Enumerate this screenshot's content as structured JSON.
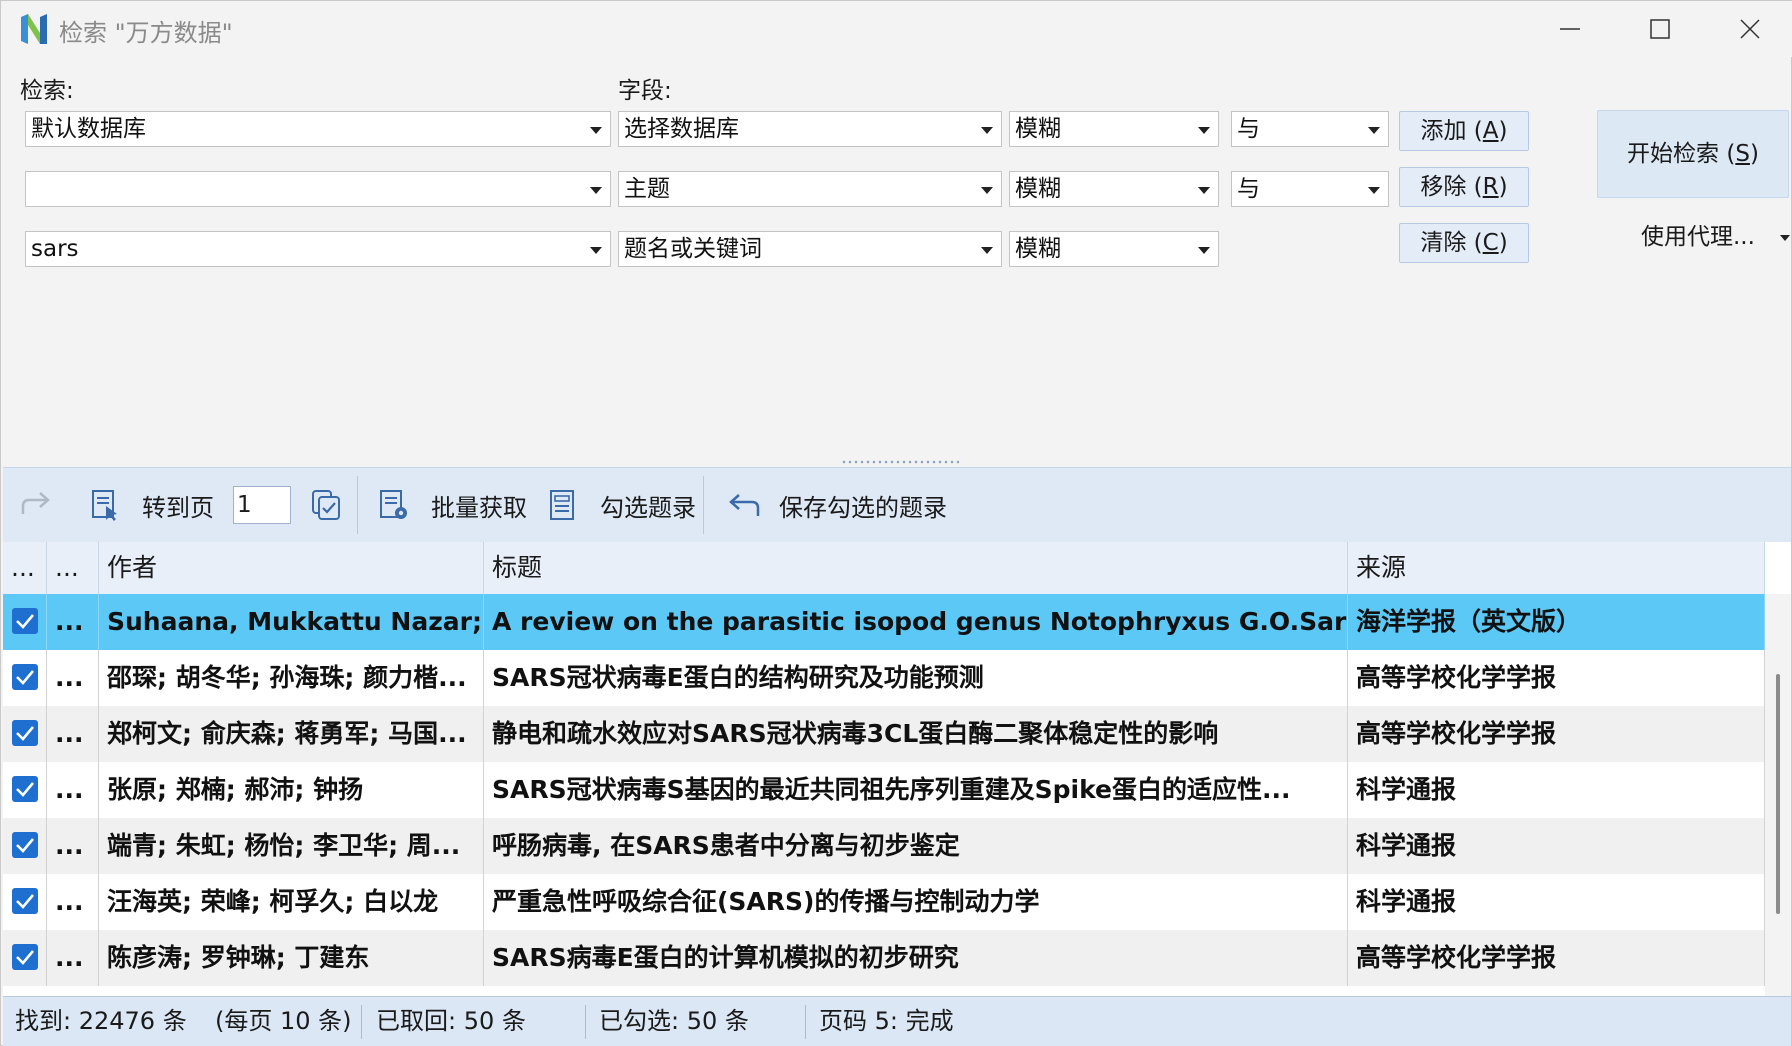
{
  "window": {
    "title": "检索 \"万方数据\"",
    "icons": {
      "app": "wanfang-logo-icon",
      "minimize": "minimize-icon",
      "maximize": "maximize-icon",
      "close": "close-icon"
    }
  },
  "search": {
    "search_label": "检索:",
    "field_label": "字段:",
    "rows": [
      {
        "database": "默认数据库",
        "field": "选择数据库",
        "match": "模糊",
        "logic": "与"
      },
      {
        "database": "",
        "field": "主题",
        "match": "模糊",
        "logic": "与"
      },
      {
        "database": "sars",
        "field": "题名或关键词",
        "match": "模糊"
      }
    ],
    "buttons": {
      "add": {
        "label": "添加 (",
        "key": "A",
        "end": ")"
      },
      "remove": {
        "label": "移除 (",
        "key": "R",
        "end": ")"
      },
      "clear": {
        "label": "清除 (",
        "key": "C",
        "end": ")"
      },
      "start": {
        "label": "开始检索 (",
        "key": "S",
        "end": ")"
      }
    },
    "proxy_label": "使用代理..."
  },
  "toolbar": {
    "goto_page_label": "转到页",
    "page_value": "1",
    "batch_fetch_label": "批量获取",
    "check_records_label": "勾选题录",
    "save_checked_label": "保存勾选的题录",
    "icons": [
      "forward-arrow-icon",
      "document-cursor-icon",
      "copy-check-icon",
      "document-gear-icon",
      "list-document-icon",
      "return-arrow-icon"
    ]
  },
  "grid": {
    "headers": [
      "...",
      "...",
      "作者",
      "标题",
      "来源"
    ],
    "rows": [
      {
        "checked": true,
        "more": "...",
        "author": "Suhaana, Mukkattu Nazar;...",
        "title": "A review on the parasitic isopod genus Notophryxus G.O.Sars,",
        "source": "海洋学报（英文版）"
      },
      {
        "checked": true,
        "more": "...",
        "author": "邵琛; 胡冬华; 孙海珠; 颜力楷...",
        "title": "SARS冠状病毒E蛋白的结构研究及功能预测",
        "source": "高等学校化学学报"
      },
      {
        "checked": true,
        "more": "...",
        "author": "郑柯文; 俞庆森; 蒋勇军; 马国...",
        "title": "静电和疏水效应对SARS冠状病毒3CL蛋白酶二聚体稳定性的影响",
        "source": "高等学校化学学报"
      },
      {
        "checked": true,
        "more": "...",
        "author": "张原; 郑楠; 郝沛; 钟扬",
        "title": "SARS冠状病毒S基因的最近共同祖先序列重建及Spike蛋白的适应性...",
        "source": "科学通报"
      },
      {
        "checked": true,
        "more": "...",
        "author": "端青; 朱虹; 杨怡; 李卫华; 周...",
        "title": "呼肠病毒, 在SARS患者中分离与初步鉴定",
        "source": "科学通报"
      },
      {
        "checked": true,
        "more": "...",
        "author": "汪海英; 荣峰; 柯孚久; 白以龙",
        "title": "严重急性呼吸综合征(SARS)的传播与控制动力学",
        "source": "科学通报"
      },
      {
        "checked": true,
        "more": "...",
        "author": "陈彦涛; 罗钟琳; 丁建东",
        "title": "SARS病毒E蛋白的计算机模拟的初步研究",
        "source": "高等学校化学学报"
      }
    ]
  },
  "status": {
    "found": "找到: 22476 条",
    "per_page": "(每页 10 条)",
    "fetched": "已取回: 50 条",
    "checked": "已勾选: 50 条",
    "page": "页码 5: 完成"
  },
  "colors": {
    "selected_row": "#5bc8f5",
    "checkbox": "#1f6fd0",
    "toolbar": "#dfe9f6"
  }
}
